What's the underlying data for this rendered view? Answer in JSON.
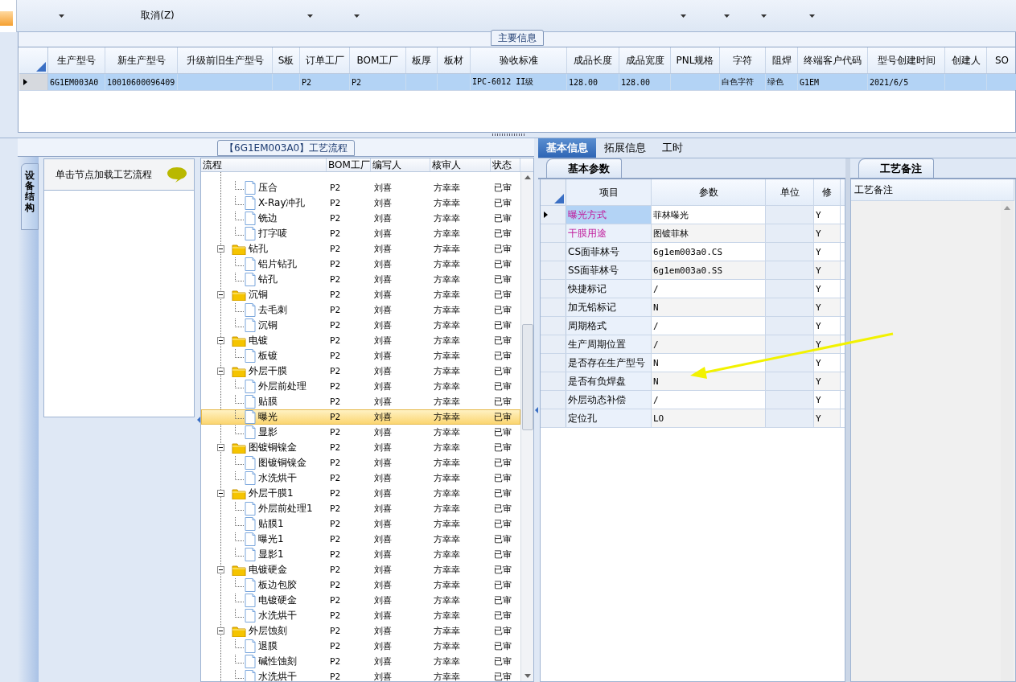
{
  "toolbar": {
    "cancel_label": "取消(Z)"
  },
  "main_info": {
    "title": "主要信息",
    "columns": [
      "生产型号",
      "新生产型号",
      "升级前旧生产型号",
      "S板",
      "订单工厂",
      "BOM工厂",
      "板厚",
      "板材",
      "验收标准",
      "成品长度",
      "成品宽度",
      "PNL规格",
      "字符",
      "阻焊",
      "终端客户代码",
      "型号创建时间",
      "创建人",
      "SO"
    ],
    "rows": [
      {
        "selected": true,
        "cells": [
          "6G1EM003A0",
          "10010600096409",
          "",
          "",
          "P2",
          "P2",
          "",
          "",
          "IPC-6012 II级",
          "128.00",
          "128.00",
          "",
          "白色字符",
          "绿色",
          "G1EM",
          "2021/6/5",
          "",
          ""
        ]
      }
    ]
  },
  "side_tab": {
    "label": "设备结构"
  },
  "side_panel": {
    "header": "单击节点加载工艺流程"
  },
  "flow": {
    "title": "【6G1EM003A0】工艺流程",
    "columns": [
      "流程",
      "BOM工厂",
      "编写人",
      "核审人",
      "状态"
    ],
    "tree": [
      {
        "kind": "continued",
        "children": [
          {
            "name": "压合",
            "bom": "P2",
            "writer": "刘喜",
            "reviewer": "方幸幸",
            "status": "已审",
            "selected": false
          },
          {
            "name": "X-Ray冲孔",
            "bom": "P2",
            "writer": "刘喜",
            "reviewer": "方幸幸",
            "status": "已审",
            "selected": false
          },
          {
            "name": "铣边",
            "bom": "P2",
            "writer": "刘喜",
            "reviewer": "方幸幸",
            "status": "已审",
            "selected": false
          },
          {
            "name": "打字唛",
            "bom": "P2",
            "writer": "刘喜",
            "reviewer": "方幸幸",
            "status": "已审",
            "selected": false
          }
        ]
      },
      {
        "kind": "group",
        "name": "钻孔",
        "bom": "P2",
        "writer": "刘喜",
        "reviewer": "方幸幸",
        "status": "已审",
        "selected": false,
        "expanded": true,
        "children": [
          {
            "name": "铝片钻孔",
            "bom": "P2",
            "writer": "刘喜",
            "reviewer": "方幸幸",
            "status": "已审",
            "selected": false
          },
          {
            "name": "钻孔",
            "bom": "P2",
            "writer": "刘喜",
            "reviewer": "方幸幸",
            "status": "已审",
            "selected": false
          }
        ]
      },
      {
        "kind": "group",
        "name": "沉铜",
        "bom": "P2",
        "writer": "刘喜",
        "reviewer": "方幸幸",
        "status": "已审",
        "selected": false,
        "expanded": true,
        "children": [
          {
            "name": "去毛刺",
            "bom": "P2",
            "writer": "刘喜",
            "reviewer": "方幸幸",
            "status": "已审",
            "selected": false
          },
          {
            "name": "沉铜",
            "bom": "P2",
            "writer": "刘喜",
            "reviewer": "方幸幸",
            "status": "已审",
            "selected": false
          }
        ]
      },
      {
        "kind": "group",
        "name": "电镀",
        "bom": "P2",
        "writer": "刘喜",
        "reviewer": "方幸幸",
        "status": "已审",
        "selected": false,
        "expanded": true,
        "children": [
          {
            "name": "板镀",
            "bom": "P2",
            "writer": "刘喜",
            "reviewer": "方幸幸",
            "status": "已审",
            "selected": false
          }
        ]
      },
      {
        "kind": "group",
        "name": "外层干膜",
        "bom": "P2",
        "writer": "刘喜",
        "reviewer": "方幸幸",
        "status": "已审",
        "selected": false,
        "expanded": true,
        "children": [
          {
            "name": "外层前处理",
            "bom": "P2",
            "writer": "刘喜",
            "reviewer": "方幸幸",
            "status": "已审",
            "selected": false
          },
          {
            "name": "贴膜",
            "bom": "P2",
            "writer": "刘喜",
            "reviewer": "方幸幸",
            "status": "已审",
            "selected": false
          },
          {
            "name": "曝光",
            "bom": "P2",
            "writer": "刘喜",
            "reviewer": "方幸幸",
            "status": "已审",
            "selected": true
          },
          {
            "name": "显影",
            "bom": "P2",
            "writer": "刘喜",
            "reviewer": "方幸幸",
            "status": "已审",
            "selected": false
          }
        ]
      },
      {
        "kind": "group",
        "name": "图镀铜镍金",
        "bom": "P2",
        "writer": "刘喜",
        "reviewer": "方幸幸",
        "status": "已审",
        "selected": false,
        "expanded": true,
        "children": [
          {
            "name": "图镀铜镍金",
            "bom": "P2",
            "writer": "刘喜",
            "reviewer": "方幸幸",
            "status": "已审",
            "selected": false
          },
          {
            "name": "水洗烘干",
            "bom": "P2",
            "writer": "刘喜",
            "reviewer": "方幸幸",
            "status": "已审",
            "selected": false
          }
        ]
      },
      {
        "kind": "group",
        "name": "外层干膜1",
        "bom": "P2",
        "writer": "刘喜",
        "reviewer": "方幸幸",
        "status": "已审",
        "selected": false,
        "expanded": true,
        "children": [
          {
            "name": "外层前处理1",
            "bom": "P2",
            "writer": "刘喜",
            "reviewer": "方幸幸",
            "status": "已审",
            "selected": false
          },
          {
            "name": "贴膜1",
            "bom": "P2",
            "writer": "刘喜",
            "reviewer": "方幸幸",
            "status": "已审",
            "selected": false
          },
          {
            "name": "曝光1",
            "bom": "P2",
            "writer": "刘喜",
            "reviewer": "方幸幸",
            "status": "已审",
            "selected": false
          },
          {
            "name": "显影1",
            "bom": "P2",
            "writer": "刘喜",
            "reviewer": "方幸幸",
            "status": "已审",
            "selected": false
          }
        ]
      },
      {
        "kind": "group",
        "name": "电镀硬金",
        "bom": "P2",
        "writer": "刘喜",
        "reviewer": "方幸幸",
        "status": "已审",
        "selected": false,
        "expanded": true,
        "children": [
          {
            "name": "板边包胶",
            "bom": "P2",
            "writer": "刘喜",
            "reviewer": "方幸幸",
            "status": "已审",
            "selected": false
          },
          {
            "name": "电镀硬金",
            "bom": "P2",
            "writer": "刘喜",
            "reviewer": "方幸幸",
            "status": "已审",
            "selected": false
          },
          {
            "name": "水洗烘干",
            "bom": "P2",
            "writer": "刘喜",
            "reviewer": "方幸幸",
            "status": "已审",
            "selected": false
          }
        ]
      },
      {
        "kind": "group",
        "name": "外层蚀刻",
        "bom": "P2",
        "writer": "刘喜",
        "reviewer": "方幸幸",
        "status": "已审",
        "selected": false,
        "expanded": true,
        "children": [
          {
            "name": "退膜",
            "bom": "P2",
            "writer": "刘喜",
            "reviewer": "方幸幸",
            "status": "已审",
            "selected": false
          },
          {
            "name": "碱性蚀刻",
            "bom": "P2",
            "writer": "刘喜",
            "reviewer": "方幸幸",
            "status": "已审",
            "selected": false
          },
          {
            "name": "水洗烘干",
            "bom": "P2",
            "writer": "刘喜",
            "reviewer": "方幸幸",
            "status": "已审",
            "selected": false
          }
        ]
      }
    ]
  },
  "detail_tabs": [
    {
      "label": "基本信息",
      "selected": true
    },
    {
      "label": "拓展信息",
      "selected": false
    },
    {
      "label": "工时",
      "selected": false
    }
  ],
  "params": {
    "title": "基本参数",
    "columns": [
      "项目",
      "参数",
      "单位",
      "修"
    ],
    "rows": [
      {
        "item": "曝光方式",
        "value": "菲林曝光",
        "modified": "Y",
        "highlight": true,
        "selected": true
      },
      {
        "item": "干膜用途",
        "value": "图镀菲林",
        "modified": "Y",
        "highlight": true,
        "selected": false
      },
      {
        "item": "CS面菲林号",
        "value": "6g1em003a0.CS",
        "modified": "Y",
        "highlight": false,
        "selected": false
      },
      {
        "item": "SS面菲林号",
        "value": "6g1em003a0.SS",
        "modified": "Y",
        "highlight": false,
        "selected": false
      },
      {
        "item": "快捷标记",
        "value": "/",
        "modified": "Y",
        "highlight": false,
        "selected": false
      },
      {
        "item": "加无铅标记",
        "value": "N",
        "modified": "Y",
        "highlight": false,
        "selected": false
      },
      {
        "item": "周期格式",
        "value": "/",
        "modified": "Y",
        "highlight": false,
        "selected": false
      },
      {
        "item": "生产周期位置",
        "value": "/",
        "modified": "Y",
        "highlight": false,
        "selected": false
      },
      {
        "item": "是否存在生产型号",
        "value": "N",
        "modified": "Y",
        "highlight": false,
        "selected": false
      },
      {
        "item": "是否有负焊盘",
        "value": "N",
        "modified": "Y",
        "highlight": false,
        "selected": false
      },
      {
        "item": "外层动态补偿",
        "value": "/",
        "modified": "Y",
        "highlight": false,
        "selected": false
      },
      {
        "item": "定位孔",
        "value": "LO",
        "modified": "Y",
        "highlight": false,
        "selected": false
      }
    ]
  },
  "notes": {
    "title": "工艺备注",
    "column": "工艺备注"
  }
}
